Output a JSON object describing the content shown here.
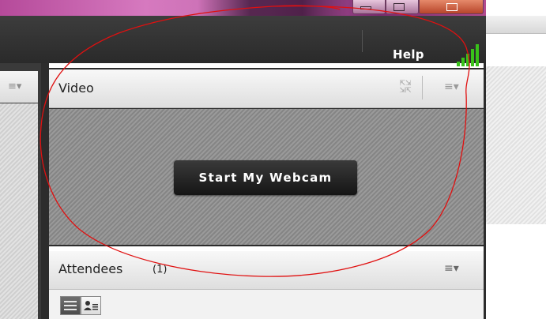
{
  "toolbar": {
    "help_label": "Help"
  },
  "video_pod": {
    "title": "Video",
    "start_webcam_label": "Start My Webcam"
  },
  "attendees_pod": {
    "title": "Attendees",
    "count": "(1)"
  },
  "icons": {
    "signal": "connection-strength-icon",
    "expand": "fullscreen-icon",
    "pod_menu": "pod-menu-icon",
    "list_view": "list-view-icon",
    "user_view": "user-view-icon"
  },
  "colors": {
    "signal_green": "#39c21a",
    "annotation_red": "#e01010",
    "app_bar": "#2f2f2f"
  }
}
